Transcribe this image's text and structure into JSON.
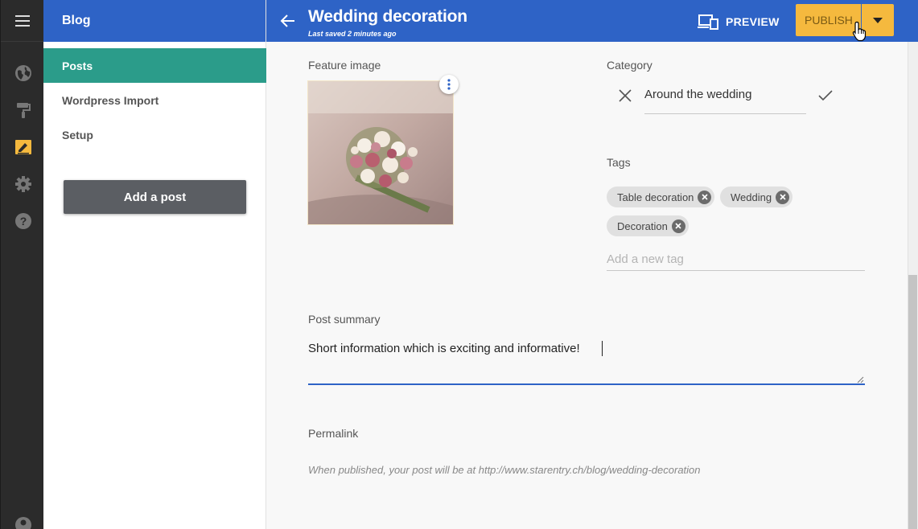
{
  "rail": {
    "icons": [
      "menu-icon",
      "globe-icon",
      "paint-roller-icon",
      "blog-edit-icon",
      "gear-icon",
      "help-icon",
      "user-icon"
    ],
    "active_color": "#f5b93e"
  },
  "sidebar": {
    "header": "Blog",
    "items": [
      {
        "label": "Posts",
        "active": true
      },
      {
        "label": "Wordpress Import",
        "active": false
      },
      {
        "label": "Setup",
        "active": false
      }
    ],
    "add_button": "Add a post"
  },
  "topbar": {
    "title": "Wedding decoration",
    "subtitle": "Last saved 2 minutes ago",
    "preview_label": "PREVIEW",
    "publish_label": "PUBLISH"
  },
  "form": {
    "feature_image_label": "Feature image",
    "category_label": "Category",
    "category_value": "Around the wedding",
    "tags_label": "Tags",
    "tags": [
      "Table decoration",
      "Wedding",
      "Decoration"
    ],
    "tag_placeholder": "Add a new tag",
    "summary_label": "Post summary",
    "summary_value": "Short information which is exciting and informative!",
    "permalink_label": "Permalink",
    "permalink_text": "When published, your post will be at http://www.starentry.ch/blog/wedding-decoration"
  },
  "colors": {
    "header_blue": "#2e63c6",
    "active_teal": "#2b9c8a",
    "publish_yellow": "#f5b93e"
  }
}
